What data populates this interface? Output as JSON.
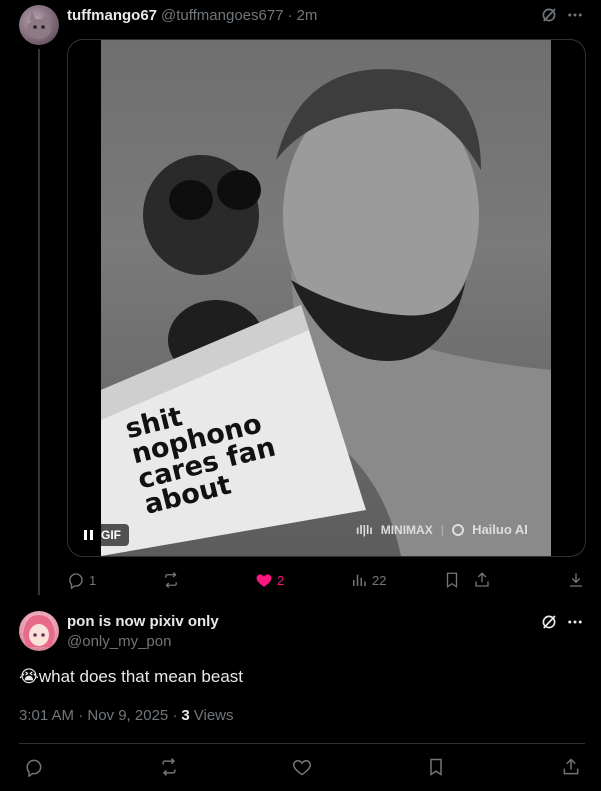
{
  "tweet": {
    "display_name": "tuffmango67",
    "handle": "@tuffmangoes677",
    "dot": "·",
    "time": "2m",
    "gif_badge": "GIF",
    "book_lines": [
      "shit",
      "nophono",
      "cares fan",
      "about"
    ],
    "watermark_left": "MINIMAX",
    "watermark_right": "Hailuo AI",
    "reply_count": "1",
    "like_count": "2",
    "view_count": "22",
    "like_color": "#f91880"
  },
  "reply": {
    "display_name": "pon is now pixiv only",
    "handle": "@only_my_pon",
    "emoji": "😭",
    "text": "what does that mean beast",
    "timestamp": "3:01 AM · Nov 9, 2025 ·",
    "views_count": "3",
    "views_label": "Views"
  }
}
